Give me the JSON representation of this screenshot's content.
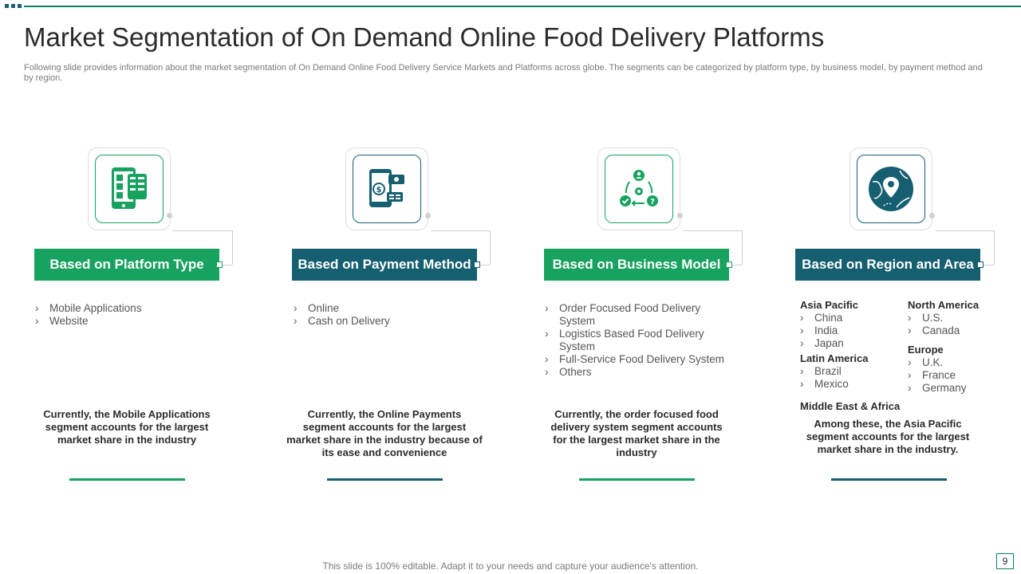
{
  "slide": {
    "title": "Market Segmentation of On Demand Online Food Delivery Platforms",
    "subtitle": "Following slide provides information about the market segmentation of On Demand Online Food Delivery Service Markets and Platforms across globe. The segments can be categorized by platform type, by business model, by payment method and by region.",
    "footer": "This slide is 100% editable. Adapt it to your needs and capture your audience's attention.",
    "page_number": "9"
  },
  "colors": {
    "green": "#17a25f",
    "teal": "#155f70"
  },
  "segments": [
    {
      "icon": "smartphone-app-icon",
      "heading": "Based on Platform Type",
      "items": [
        "Mobile Applications",
        "Website"
      ],
      "note": "Currently, the Mobile Applications segment accounts for the largest market share in the industry"
    },
    {
      "icon": "mobile-payment-icon",
      "heading": "Based on Payment Method",
      "items": [
        "Online",
        "Cash on Delivery"
      ],
      "note": "Currently, the Online Payments segment accounts for the largest market share in the industry because of its ease and convenience"
    },
    {
      "icon": "business-cycle-icon",
      "heading": "Based on Business Model",
      "items": [
        "Order Focused Food Delivery System",
        "Logistics Based Food Delivery System",
        "Full-Service Food Delivery System",
        "Others"
      ],
      "note": "Currently, the order focused food delivery system segment accounts for the largest market share in the industry"
    },
    {
      "icon": "globe-location-icon",
      "heading": "Based on Region and Area",
      "regions": {
        "asia_pacific": {
          "name": "Asia Pacific",
          "items": [
            "China",
            "India",
            "Japan"
          ]
        },
        "latin_america": {
          "name": "Latin America",
          "items": [
            "Brazil",
            "Mexico"
          ]
        },
        "middle_east_africa": {
          "name": "Middle East & Africa"
        },
        "north_america": {
          "name": "North America",
          "items": [
            "U.S.",
            "Canada"
          ]
        },
        "europe": {
          "name": "Europe",
          "items": [
            "U.K.",
            "France",
            "Germany"
          ]
        }
      },
      "note": "Among these, the Asia Pacific segment accounts for the largest market share in the industry."
    }
  ]
}
